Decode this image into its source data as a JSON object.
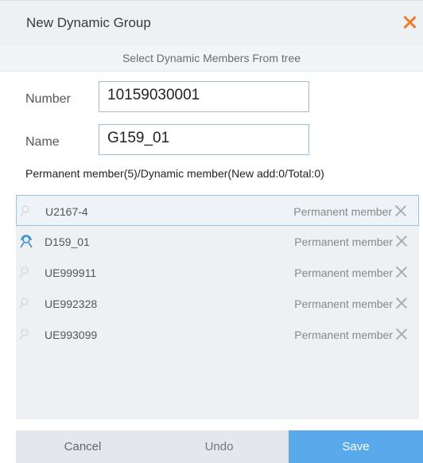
{
  "dialog": {
    "title": "New Dynamic Group",
    "subheader": "Select Dynamic Members From tree"
  },
  "form": {
    "number_label": "Number",
    "number_value": "10159030001",
    "name_label": "Name",
    "name_value": "G159_01"
  },
  "members": {
    "summary": "Permanent member(5)/Dynamic member(New add:0/Total:0)",
    "rows": [
      {
        "name": "U2167-4",
        "role": "Permanent member",
        "icon": "user-icon",
        "selected": true
      },
      {
        "name": "D159_01",
        "role": "Permanent member",
        "icon": "dispatcher-icon",
        "selected": false
      },
      {
        "name": "UE999911",
        "role": "Permanent member",
        "icon": "user-icon",
        "selected": false
      },
      {
        "name": "UE992328",
        "role": "Permanent member",
        "icon": "user-icon",
        "selected": false
      },
      {
        "name": "UE993099",
        "role": "Permanent member",
        "icon": "user-icon",
        "selected": false
      }
    ]
  },
  "footer": {
    "cancel_label": "Cancel",
    "undo_label": "Undo",
    "save_label": "Save"
  },
  "colors": {
    "accent": "#5aa9ea",
    "close": "#f07c2a",
    "dispatcher_icon": "#3a8fd6"
  }
}
